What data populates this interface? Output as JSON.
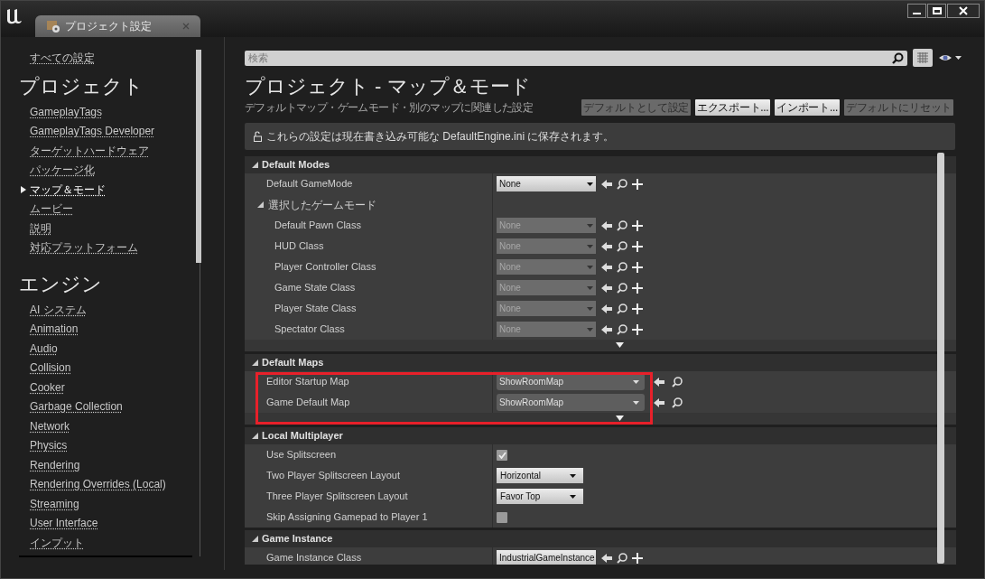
{
  "window": {
    "tab_title": "プロジェクト設定"
  },
  "sidebar": {
    "all_settings": "すべての設定",
    "groups": [
      {
        "heading": "プロジェクト",
        "items": [
          {
            "label": "GameplayTags",
            "selected": false
          },
          {
            "label": "GameplayTags Developer",
            "selected": false
          },
          {
            "label": "ターゲットハードウェア",
            "selected": false
          },
          {
            "label": "パッケージ化",
            "selected": false
          },
          {
            "label": "マップ＆モード",
            "selected": true
          },
          {
            "label": "ムービー",
            "selected": false
          },
          {
            "label": "説明",
            "selected": false
          },
          {
            "label": "対応プラットフォーム",
            "selected": false
          }
        ]
      },
      {
        "heading": "エンジン",
        "items": [
          {
            "label": "AI システム",
            "selected": false
          },
          {
            "label": "Animation",
            "selected": false
          },
          {
            "label": "Audio",
            "selected": false
          },
          {
            "label": "Collision",
            "selected": false
          },
          {
            "label": "Cooker",
            "selected": false
          },
          {
            "label": "Garbage Collection",
            "selected": false
          },
          {
            "label": "Network",
            "selected": false
          },
          {
            "label": "Physics",
            "selected": false
          },
          {
            "label": "Rendering",
            "selected": false
          },
          {
            "label": "Rendering Overrides (Local)",
            "selected": false
          },
          {
            "label": "Streaming",
            "selected": false
          },
          {
            "label": "User Interface",
            "selected": false
          },
          {
            "label": "インプット",
            "selected": false
          }
        ]
      }
    ]
  },
  "search": {
    "placeholder": "検索"
  },
  "page": {
    "title": "プロジェクト - マップ＆モード",
    "subtitle": "デフォルトマップ・ゲームモード・別のマップに関連した設定",
    "buttons": [
      {
        "label": "デフォルトとして設定",
        "disabled": true
      },
      {
        "label": "エクスポート...",
        "disabled": false
      },
      {
        "label": "インポート...",
        "disabled": false
      },
      {
        "label": "デフォルトにリセット",
        "disabled": true
      }
    ]
  },
  "notice": "これらの設定は現在書き込み可能な DefaultEngine.ini に保存されます。",
  "sections": [
    {
      "title": "Default Modes",
      "expanded": true,
      "highlighted": false,
      "show_advanced": true,
      "rows": [
        {
          "kind": "object",
          "label": "Default GameMode",
          "value": "None",
          "disabled": false
        },
        {
          "kind": "group",
          "label": "選択したゲームモード",
          "expanded": true,
          "children": [
            {
              "kind": "object",
              "label": "Default Pawn Class",
              "value": "None",
              "disabled": true
            },
            {
              "kind": "object",
              "label": "HUD Class",
              "value": "None",
              "disabled": true
            },
            {
              "kind": "object",
              "label": "Player Controller Class",
              "value": "None",
              "disabled": true
            },
            {
              "kind": "object",
              "label": "Game State Class",
              "value": "None",
              "disabled": true
            },
            {
              "kind": "object",
              "label": "Player State Class",
              "value": "None",
              "disabled": true
            },
            {
              "kind": "object",
              "label": "Spectator Class",
              "value": "None",
              "disabled": true
            }
          ]
        }
      ]
    },
    {
      "title": "Default Maps",
      "expanded": true,
      "highlighted": true,
      "show_advanced": true,
      "rows": [
        {
          "kind": "map",
          "label": "Editor Startup Map",
          "value": "ShowRoomMap"
        },
        {
          "kind": "map",
          "label": "Game Default Map",
          "value": "ShowRoomMap"
        }
      ]
    },
    {
      "title": "Local Multiplayer",
      "expanded": true,
      "highlighted": false,
      "show_advanced": false,
      "rows": [
        {
          "kind": "checkbox",
          "label": "Use Splitscreen",
          "checked": true
        },
        {
          "kind": "enum",
          "label": "Two Player Splitscreen Layout",
          "value": "Horizontal"
        },
        {
          "kind": "enum",
          "label": "Three Player Splitscreen Layout",
          "value": "Favor Top"
        },
        {
          "kind": "checkbox",
          "label": "Skip Assigning Gamepad to Player 1",
          "checked": false
        }
      ]
    },
    {
      "title": "Game Instance",
      "expanded": true,
      "highlighted": false,
      "show_advanced": false,
      "rows": [
        {
          "kind": "object",
          "label": "Game Instance Class",
          "value": "IndustrialGameInstance",
          "disabled": false
        }
      ]
    }
  ]
}
